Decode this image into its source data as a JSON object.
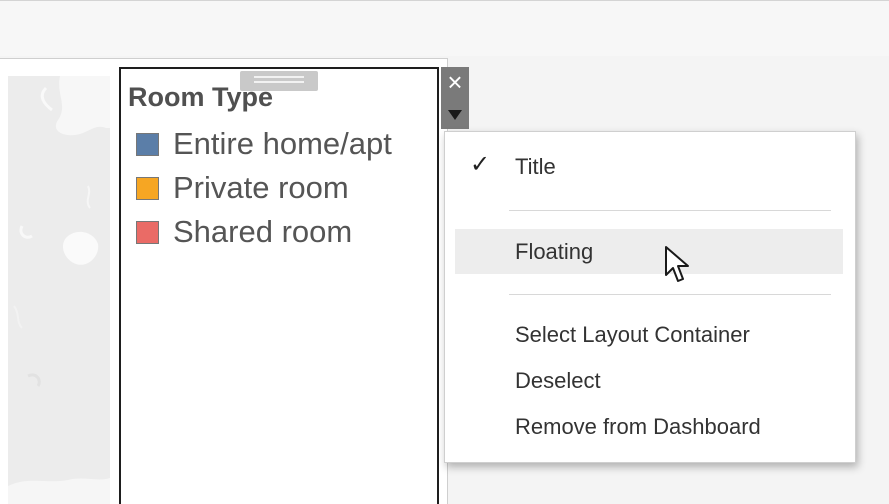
{
  "legend": {
    "title": "Room Type",
    "items": [
      {
        "label": "Entire home/apt",
        "color": "#5b7ea8"
      },
      {
        "label": "Private room",
        "color": "#f6a623"
      },
      {
        "label": "Shared room",
        "color": "#ea6b66"
      }
    ]
  },
  "controls": {
    "close_glyph": "×"
  },
  "menu": {
    "check_glyph": "✓",
    "title_label": "Title",
    "floating_label": "Floating",
    "select_container_label": "Select Layout Container",
    "deselect_label": "Deselect",
    "remove_label": "Remove from Dashboard"
  },
  "colors": {
    "legend_border": "#1e1e1e",
    "control_strip": "#7a7a7a",
    "menu_hover": "#ededed"
  }
}
